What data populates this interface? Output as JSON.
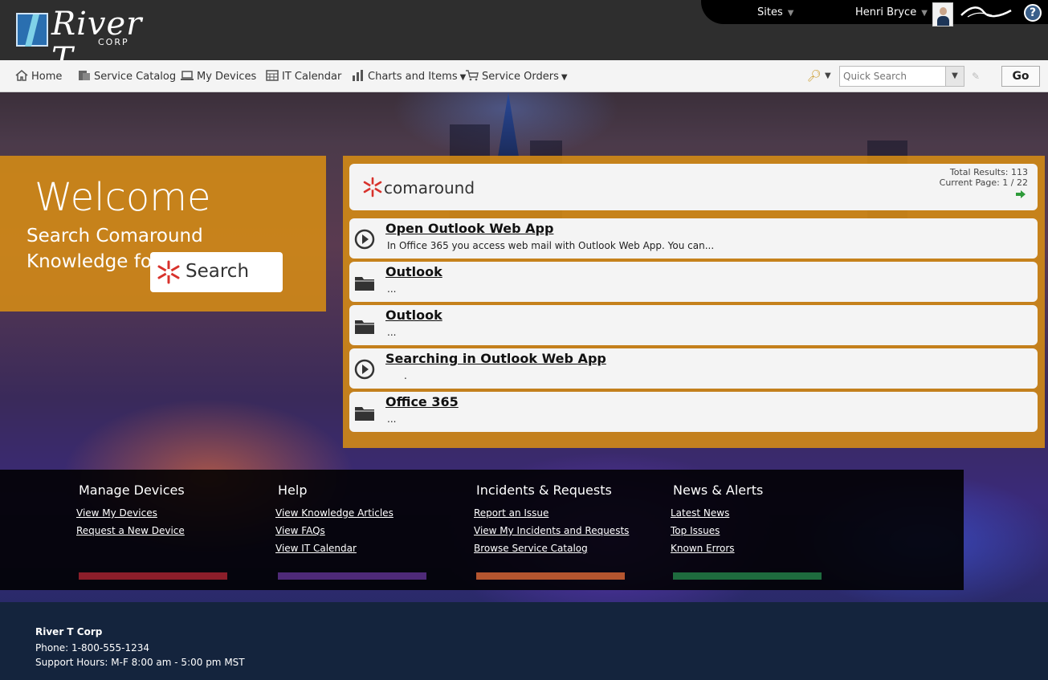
{
  "header": {
    "logo_text": "River T",
    "logo_sub": "CORP",
    "sites_label": "Sites",
    "user_name": "Henri Bryce",
    "help_glyph": "?"
  },
  "nav": {
    "items": [
      {
        "label": "Home",
        "icon": "home-icon"
      },
      {
        "label": "Service Catalog",
        "icon": "catalog-icon"
      },
      {
        "label": "My Devices",
        "icon": "laptop-icon"
      },
      {
        "label": "IT Calendar",
        "icon": "calendar-icon"
      },
      {
        "label": "Charts and Items",
        "icon": "bar-chart-icon",
        "dropdown": "▼"
      },
      {
        "label": "Service Orders",
        "icon": "cart-icon",
        "dropdown": "▼"
      }
    ],
    "quick_search_placeholder": "Quick Search",
    "go_label": "Go"
  },
  "welcome": {
    "title": "Welcome",
    "subtitle": "Search Comaround Knowledge for Help:",
    "search_button_label": "Search"
  },
  "results": {
    "brand": "comaround",
    "total_results": "Total Results: 113",
    "current_page": "Current Page: 1 / 22",
    "items": [
      {
        "title": "Open Outlook Web App",
        "desc": "In Office 365 you access web mail with Outlook Web App. You can...",
        "icon": "play-circle-icon"
      },
      {
        "title": "Outlook",
        "desc": "...",
        "icon": "folder-icon"
      },
      {
        "title": "Outlook",
        "desc": "...",
        "icon": "folder-icon"
      },
      {
        "title": "Searching in Outlook Web App",
        "desc": ".",
        "icon": "play-circle-icon"
      },
      {
        "title": "Office 365",
        "desc": "...",
        "icon": "folder-icon"
      }
    ]
  },
  "links": {
    "columns": [
      {
        "heading": "Manage Devices",
        "color": "#8b1e2a",
        "links": [
          "View My Devices",
          "Request a New Device"
        ]
      },
      {
        "heading": "Help",
        "color": "#4e2a78",
        "links": [
          "View Knowledge Articles",
          "View FAQs",
          "View IT Calendar"
        ]
      },
      {
        "heading": "Incidents & Requests",
        "color": "#b4552f",
        "links": [
          "Report an Issue",
          "View My Incidents and Requests",
          "Browse Service Catalog"
        ]
      },
      {
        "heading": "News & Alerts",
        "color": "#1e6b3e",
        "links": [
          "Latest News",
          "Top Issues",
          "Known Errors"
        ]
      }
    ]
  },
  "footer": {
    "company": "River T Corp",
    "phone": "Phone: 1-800-555-1234",
    "hours": "Support Hours: M-F 8:00 am - 5:00 pm MST"
  },
  "colors": {
    "accent_orange": "#d68c14",
    "header_bg": "#2e2e2e",
    "footer_bg": "#14243d"
  }
}
